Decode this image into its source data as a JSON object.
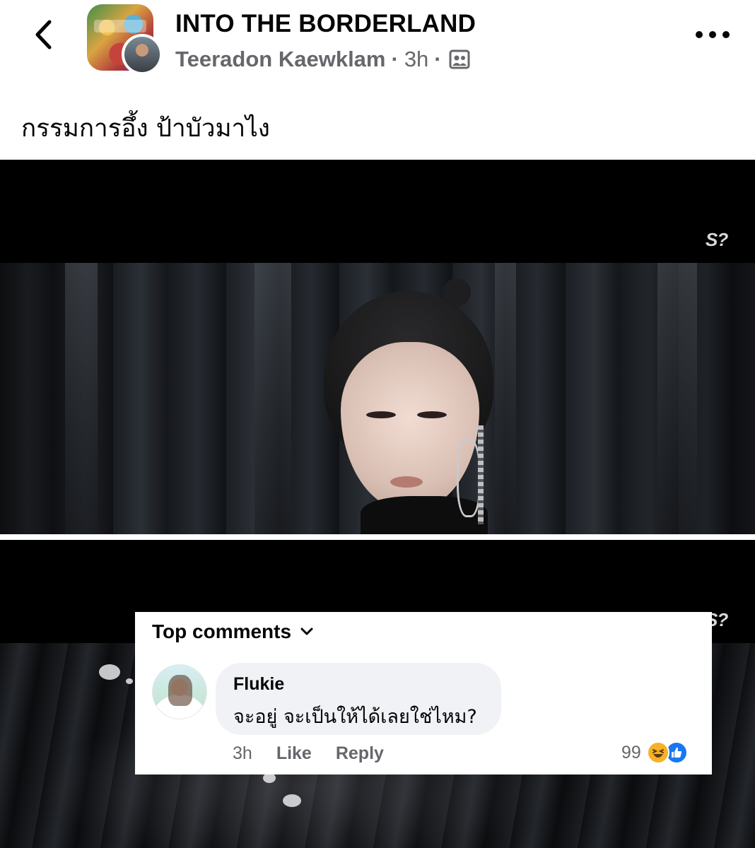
{
  "header": {
    "back_icon": "chevron-left-icon",
    "group_name": "INTO THE BORDERLAND",
    "author": "Teeradon Kaewklam",
    "separator": "·",
    "time": "3h",
    "audience_icon": "group-audience-icon",
    "more_icon": "more-horizontal-icon"
  },
  "post": {
    "text": "กรรมการอึ้ง ป้าบัวมาไง"
  },
  "media": {
    "watermark": "S?"
  },
  "comments": {
    "heading": "Top comments",
    "chevron_icon": "chevron-down-icon",
    "items": [
      {
        "name": "Flukie",
        "text": "จะอยู่ จะเป็นให้ได้เลยใช่ไหม?",
        "time": "3h",
        "like_label": "Like",
        "reply_label": "Reply",
        "reaction_count": "99",
        "reactions": [
          "haha-reaction-icon",
          "like-reaction-icon"
        ]
      }
    ]
  },
  "colors": {
    "primary_text": "#050505",
    "secondary_text": "#65676b",
    "bubble_bg": "#f0f2f5",
    "like_blue": "#1877f2",
    "haha_yellow": "#f7b125"
  }
}
